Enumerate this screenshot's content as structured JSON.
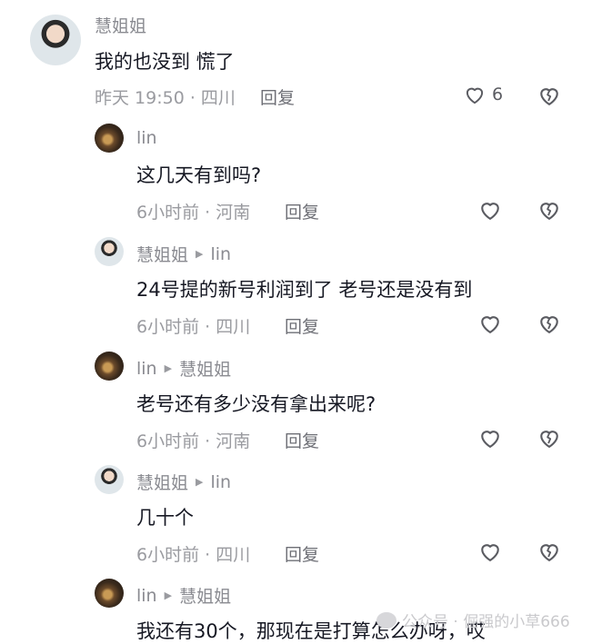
{
  "comments": [
    {
      "author": "慧姐姐",
      "text": "我的也没到 慌了",
      "time_location": "昨天 19:50 · 四川",
      "reply_label": "回复",
      "like_count": "6",
      "avatar": "woman"
    },
    {
      "author": "lin",
      "text": "这几天有到吗?",
      "time_location": "6小时前 · 河南",
      "reply_label": "回复",
      "avatar": "lin"
    },
    {
      "author": "慧姐姐",
      "reply_to": "lin",
      "text": "24号提的新号利润到了 老号还是没有到",
      "time_location": "6小时前 · 四川",
      "reply_label": "回复",
      "avatar": "woman"
    },
    {
      "author": "lin",
      "reply_to": "慧姐姐",
      "text": "老号还有多少没有拿出来呢?",
      "time_location": "6小时前 · 河南",
      "reply_label": "回复",
      "avatar": "lin"
    },
    {
      "author": "慧姐姐",
      "reply_to": "lin",
      "text": "几十个",
      "time_location": "6小时前 · 四川",
      "reply_label": "回复",
      "avatar": "woman"
    },
    {
      "author": "lin",
      "reply_to": "慧姐姐",
      "text": "我还有30个，那现在是打算怎么办呀，哎",
      "avatar": "lin"
    }
  ],
  "icons": {
    "like": "heart-outline-icon",
    "dislike": "broken-heart-icon",
    "arrow": "play-triangle-icon"
  },
  "watermark": {
    "text": "公众号 · 倔强的小草666"
  },
  "colors": {
    "text": "#161823",
    "muted": "#9a9ba0",
    "author": "#8a8b91"
  }
}
